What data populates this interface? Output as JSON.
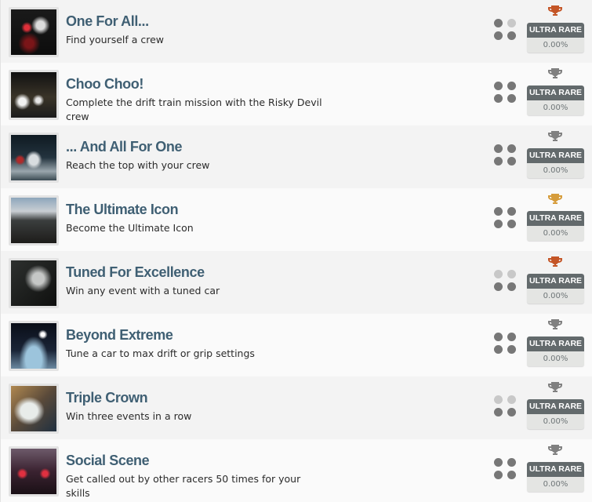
{
  "colors": {
    "trophy_bronze": "#c45526",
    "trophy_silver": "#808080",
    "trophy_gold": "#d69c3b",
    "dot_on": "#777777",
    "dot_off": "#c8c8c8",
    "title": "#3f5f73",
    "badge_bg": "#636a6c"
  },
  "achievements": [
    {
      "title": "One For All...",
      "description": "Find yourself a crew",
      "trophy": "bronze",
      "dots": [
        true,
        false,
        true,
        true
      ],
      "rarity": "ULTRA RARE",
      "percent": "0.00%",
      "thumb": "night-street-red-taillights"
    },
    {
      "title": "Choo Choo!",
      "description": "Complete the drift train mission with the Risky Devil crew",
      "trophy": "silver",
      "dots": [
        true,
        true,
        true,
        true
      ],
      "rarity": "ULTRA RARE",
      "percent": "0.00%",
      "thumb": "night-road-headlights"
    },
    {
      "title": "... And All For One",
      "description": "Reach the top with your crew",
      "trophy": "silver",
      "dots": [
        true,
        true,
        true,
        true
      ],
      "rarity": "ULTRA RARE",
      "percent": "0.00%",
      "thumb": "wet-street-white-car"
    },
    {
      "title": "The Ultimate Icon",
      "description": "Become the Ultimate Icon",
      "trophy": "gold",
      "dots": [
        true,
        true,
        true,
        true
      ],
      "rarity": "ULTRA RARE",
      "percent": "0.00%",
      "thumb": "dusk-hills-landscape"
    },
    {
      "title": "Tuned For Excellence",
      "description": "Win any event with a tuned car",
      "trophy": "bronze",
      "dots": [
        false,
        false,
        true,
        true
      ],
      "rarity": "ULTRA RARE",
      "percent": "0.00%",
      "thumb": "car-side-closeup"
    },
    {
      "title": "Beyond Extreme",
      "description": "Tune a car to max drift or grip settings",
      "trophy": "silver",
      "dots": [
        true,
        true,
        true,
        true
      ],
      "rarity": "ULTRA RARE",
      "percent": "0.00%",
      "thumb": "city-skyline-blue-car"
    },
    {
      "title": "Triple Crown",
      "description": "Win three events in a row",
      "trophy": "silver",
      "dots": [
        false,
        false,
        true,
        true
      ],
      "rarity": "ULTRA RARE",
      "percent": "0.00%",
      "thumb": "white-car-drifting"
    },
    {
      "title": "Social Scene",
      "description": "Get called out by other racers 50 times for your skills",
      "trophy": "silver",
      "dots": [
        true,
        true,
        true,
        true
      ],
      "rarity": "ULTRA RARE",
      "percent": "0.00%",
      "thumb": "car-rear-red-lights"
    }
  ]
}
